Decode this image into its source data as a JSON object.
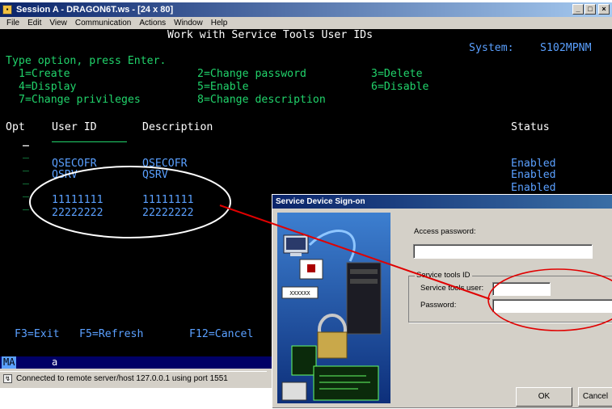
{
  "window": {
    "title": "Session A - DRAGON6T.ws - [24 x 80]",
    "menu": [
      "File",
      "Edit",
      "View",
      "Communication",
      "Actions",
      "Window",
      "Help"
    ]
  },
  "terminal": {
    "screen_title": "Work with Service Tools User IDs",
    "system_label": "System:",
    "system_name": "S102MPNM",
    "instruction": "Type option, press Enter.",
    "options": [
      "1=Create",
      "2=Change password",
      "3=Delete",
      "4=Display",
      "5=Enable",
      "6=Disable",
      "7=Change privileges",
      "8=Change description"
    ],
    "columns": {
      "opt": "Opt",
      "user_id": "User ID",
      "description": "Description",
      "status": "Status"
    },
    "rows": [
      {
        "opt": "_",
        "user_id": "QSECOFR",
        "description": "QSECOFR",
        "status": "Enabled"
      },
      {
        "opt": "_",
        "user_id": "QSRV",
        "description": "QSRV",
        "status": "Enabled"
      },
      {
        "opt": "_",
        "user_id": "",
        "description": "",
        "status": "Enabled"
      },
      {
        "opt": "_",
        "user_id": "11111111",
        "description": "11111111",
        "status": ""
      },
      {
        "opt": "_",
        "user_id": "22222222",
        "description": "22222222",
        "status": ""
      }
    ],
    "function_keys": [
      "F3=Exit",
      "F5=Refresh",
      "F12=Cancel"
    ],
    "oia": {
      "indicator": "MA",
      "cursor_char": "a"
    }
  },
  "statusbar": {
    "text": "Connected to remote server/host 127.0.0.1 using port 1551"
  },
  "dialog": {
    "title": "Service Device Sign-on",
    "access_password_label": "Access password:",
    "group_label": "Service tools ID",
    "user_label": "Service tools user:",
    "password_label": "Password:",
    "ok_label": "OK",
    "cancel_label": "Cancel",
    "art_badge": "XXXXXX"
  },
  "colors": {
    "terminal_green": "#21d36b",
    "terminal_blue": "#5aa0ff",
    "annotation": "#e00000"
  }
}
